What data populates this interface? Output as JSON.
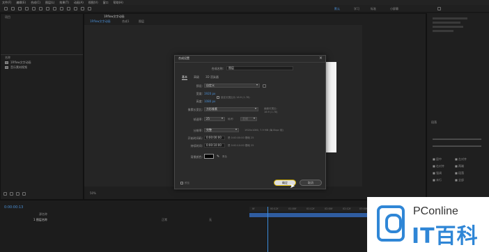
{
  "menubar": {
    "items": [
      "文件(F)",
      "编辑(E)",
      "合成(C)",
      "图层(L)",
      "效果(T)",
      "动画(A)",
      "视图(V)",
      "窗口",
      "帮助(H)"
    ]
  },
  "workspace": {
    "tabs": [
      "默认",
      "学习",
      "标准",
      "小屏幕"
    ],
    "active": "默认"
  },
  "project": {
    "panel_tab": "项目",
    "header": "名称",
    "items": [
      "1Rflow文字动画",
      "音乐素材视频"
    ]
  },
  "composition": {
    "tabs": [
      "1Rflow文字动画",
      "合成1",
      "图层"
    ],
    "zoom": "50%"
  },
  "dialog": {
    "title": "合成设置",
    "name_label": "合成名称:",
    "name_value": "图层",
    "tabs": [
      "基本",
      "高级",
      "3D 渲染器"
    ],
    "preset_label": "预设:",
    "preset_value": "自定义",
    "width_label": "宽度:",
    "width_value": "1920 px",
    "height_label": "高度:",
    "height_value": "1080 px",
    "lock_ratio": "锁定长宽比为 16:9 (1.78)",
    "pixel_aspect_label": "像素长宽比:",
    "pixel_aspect_value": "方形像素",
    "frame_aspect_label": "画面长宽比:",
    "frame_aspect_value": "16:9 (1.78)",
    "frame_rate_label": "帧速率:",
    "frame_rate_value": "25",
    "frame_rate_unit": "帧/秒",
    "drop_frame": "丢帧",
    "resolution_label": "分辨率:",
    "resolution_value": "完整",
    "resolution_info": "1920x1080, 7.9 MB (每 8bpc 帧)",
    "start_tc_label": "开始时间码:",
    "start_tc_value": "0:00:00:00",
    "start_tc_info": "是 0:00:00:00 基础 25",
    "duration_label": "持续时间:",
    "duration_value": "0:00:10:00",
    "duration_info": "是 0:00:10:00 基础 25",
    "bg_color_label": "背景颜色:",
    "bg_color_name": "黑色",
    "preview_label": "预览",
    "ok_label": "确定",
    "cancel_label": "取消"
  },
  "right_panel": {
    "align_title": "段落",
    "items": [
      "■ 居中",
      "■ 左对齐",
      "■ 右对齐",
      "■ 两端",
      "■ 强调",
      "■ 段落",
      "■ 末行",
      "■ 全部"
    ]
  },
  "timeline": {
    "timecode": "0:00:00:13",
    "layer_header": "源名称",
    "layer_name": "1 图层名称",
    "mode": "正常",
    "parent": "无",
    "ticks": [
      "0f",
      "00:12f",
      "01:00f",
      "01:12f",
      "02:00f",
      "02:12f",
      "03:00f"
    ]
  },
  "watermark": {
    "brand_en": "PConline",
    "brand_cn": "IT百科"
  }
}
